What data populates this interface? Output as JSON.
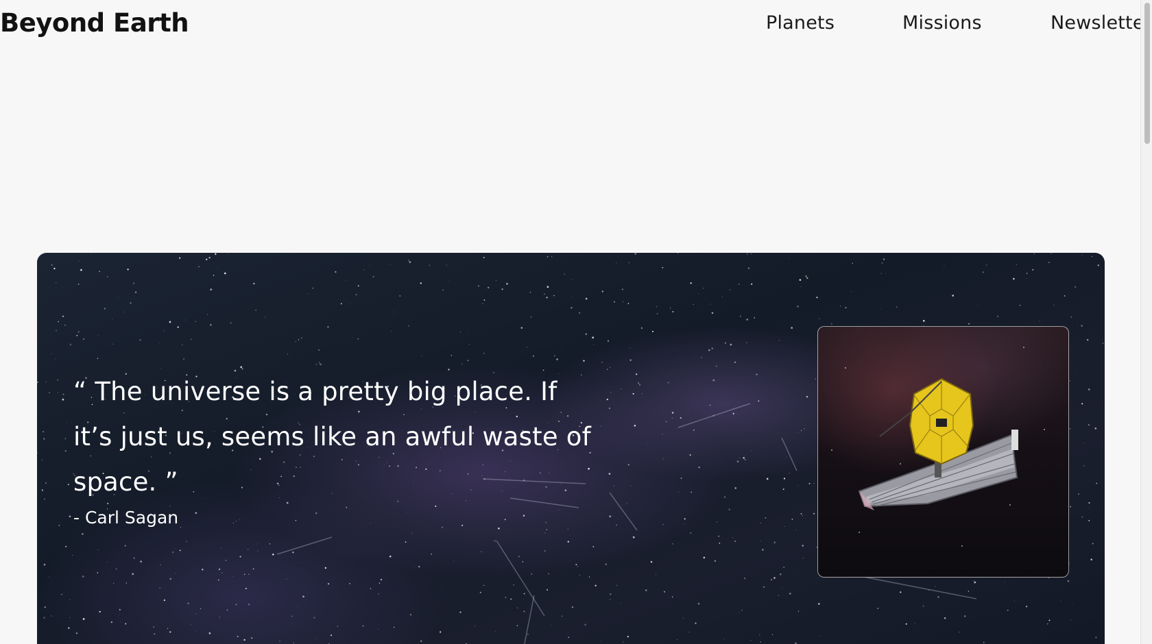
{
  "header": {
    "brand": "Beyond Earth",
    "nav": [
      "Planets",
      "Missions",
      "Newsletter"
    ]
  },
  "hero": {
    "quote": "“ The universe is a pretty big place. If it’s just us, seems like an awful waste of space. ”",
    "author": "- Carl Sagan",
    "image_icon": "telescope-icon"
  },
  "colors": {
    "background": "#f7f7f7",
    "text_dark": "#121212",
    "hero_text": "#ffffff",
    "mirror_gold": "#e6c51c"
  }
}
